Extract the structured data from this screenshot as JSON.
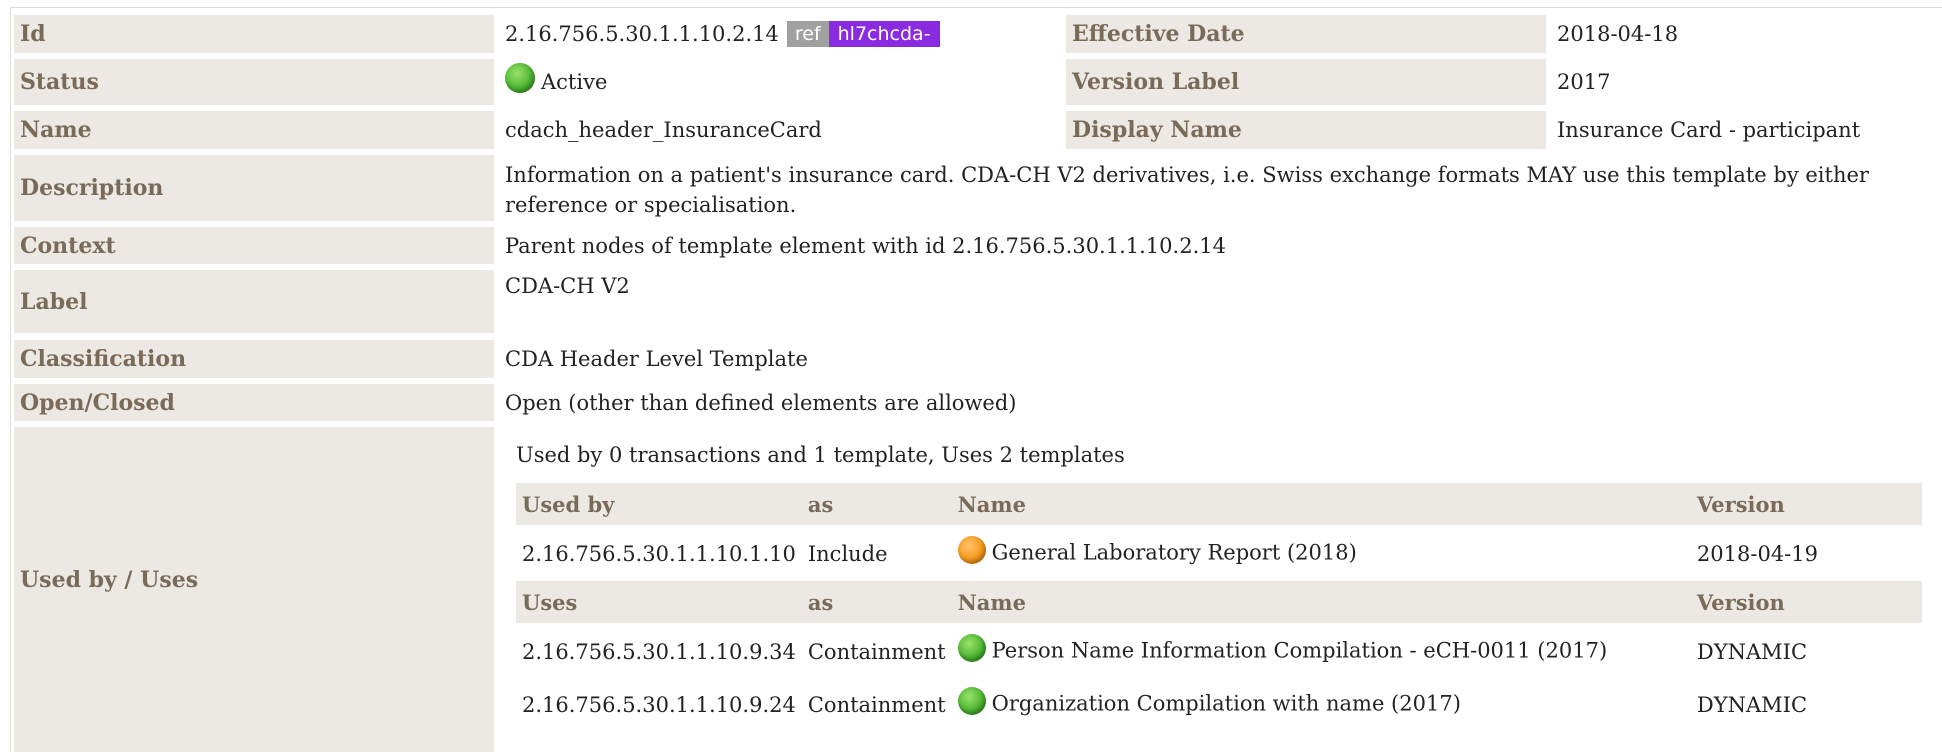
{
  "rows": {
    "id": {
      "label": "Id",
      "value": "2.16.756.5.30.1.1.10.2.14",
      "badge_ref": "ref",
      "badge_prefix": "hl7chcda-"
    },
    "effective_date": {
      "label": "Effective Date",
      "value": "2018-04-18"
    },
    "status": {
      "label": "Status",
      "value": "Active"
    },
    "version_label": {
      "label": "Version Label",
      "value": "2017"
    },
    "name": {
      "label": "Name",
      "value": "cdach_header_InsuranceCard"
    },
    "display_name": {
      "label": "Display Name",
      "value": "Insurance Card - participant"
    },
    "description": {
      "label": "Description",
      "value": "Information on a patient's insurance card. CDA-CH V2 derivatives, i.e. Swiss exchange formats MAY use this template by either reference or specialisation."
    },
    "context": {
      "label": "Context",
      "value": "Parent nodes of template element with id 2.16.756.5.30.1.1.10.2.14"
    },
    "label": {
      "label": "Label",
      "value": "CDA-CH V2"
    },
    "classification": {
      "label": "Classification",
      "value": "CDA Header Level Template"
    },
    "open_closed": {
      "label": "Open/Closed",
      "value": "Open (other than defined elements are allowed)"
    },
    "used_by_uses": {
      "label": "Used by / Uses"
    }
  },
  "usage": {
    "summary": "Used by 0 transactions and 1 template, Uses 2 templates",
    "used_by_header": {
      "col1": "Used by",
      "col2": "as",
      "col3": "Name",
      "col4": "Version"
    },
    "used_by": [
      {
        "id": "2.16.756.5.30.1.1.10.1.10",
        "as": "Include",
        "status_icon": "orange-status-icon",
        "name": "General Laboratory Report (2018)",
        "version": "2018-04-19"
      }
    ],
    "uses_header": {
      "col1": "Uses",
      "col2": "as",
      "col3": "Name",
      "col4": "Version"
    },
    "uses": [
      {
        "id": "2.16.756.5.30.1.1.10.9.34",
        "as": "Containment",
        "status_icon": "green-status-icon",
        "name": "Person Name Information Compilation - eCH-0011 (2017)",
        "version": "DYNAMIC"
      },
      {
        "id": "2.16.756.5.30.1.1.10.9.24",
        "as": "Containment",
        "status_icon": "green-status-icon",
        "name": "Organization Compilation with name (2017)",
        "version": "DYNAMIC"
      }
    ]
  },
  "colors": {
    "label_bg": "#ece9e4",
    "label_text": "#7a6a58",
    "ref_badge": "#a0a0a0",
    "prefix_badge": "#8a2be2",
    "status_active": "#4cb531",
    "status_draft": "#f59a1d"
  }
}
